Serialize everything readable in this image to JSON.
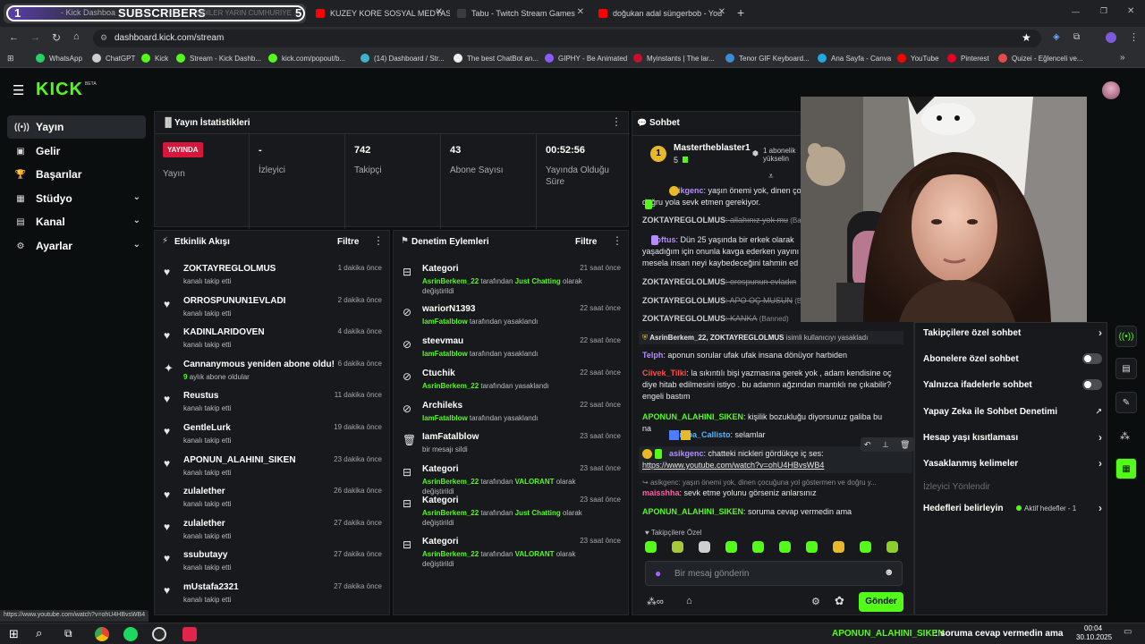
{
  "browser": {
    "tabs": [
      {
        "title": "- Kick Dashboa",
        "overlay": "SUBSCRIBERS",
        "overlay_left": "1",
        "overlay_right": "5",
        "ticker": "NDİLER YARIN CUMHURİYE"
      },
      {
        "title": "KUZEY KORE SOSYAL MEDYASI"
      },
      {
        "title": "Tabu - Twitch Stream Games"
      },
      {
        "title": "doğukan adal süngerbob - You"
      }
    ],
    "new_tab": "+",
    "url": "dashboard.kick.com/stream",
    "bookmarks": [
      "WhatsApp",
      "ChatGPT",
      "Kick",
      "Stream - Kick Dashb...",
      "kick.com/popout/b...",
      "(14) Dashboard / Str...",
      "The best ChatBot an...",
      "GIPHY - Be Animated",
      "Myinstants | The lar...",
      "Tenor GIF Keyboard...",
      "Ana Sayfa - Canva",
      "YouTube",
      "Pinterest",
      "Quizei - Eğlenceli ve..."
    ],
    "bookmark_colors": [
      "#25d366",
      "#cfcfcf",
      "#53fc18",
      "#53fc18",
      "#53fc18",
      "#3fb3c8",
      "#eeeeee",
      "#8a5cff",
      "#c8102e",
      "#3b8dd8",
      "#21a8e0",
      "#ff0000",
      "#e60023",
      "#e54b4b"
    ],
    "status_url": "https://www.youtube.com/watch?v=ohU4HBvsWB4"
  },
  "kick": {
    "logo": "KICK",
    "logo_sup": "BETA"
  },
  "sidebar": {
    "items": [
      {
        "label": "Yayın",
        "icon": "broadcast-icon",
        "glyph": "((•))",
        "active": true,
        "chevron": false
      },
      {
        "label": "Gelir",
        "icon": "income-icon",
        "glyph": "▣",
        "active": false,
        "chevron": false
      },
      {
        "label": "Başarılar",
        "icon": "trophy-icon",
        "glyph": "🏆",
        "active": false,
        "chevron": false
      },
      {
        "label": "Stüdyo",
        "icon": "studio-icon",
        "glyph": "▦",
        "active": false,
        "chevron": true
      },
      {
        "label": "Kanal",
        "icon": "channel-icon",
        "glyph": "▤",
        "active": false,
        "chevron": true
      },
      {
        "label": "Ayarlar",
        "icon": "settings-icon",
        "glyph": "⚙",
        "active": false,
        "chevron": true
      }
    ]
  },
  "stats": {
    "title": "Yayın İstatistikleri",
    "live_badge": "YAYINDA",
    "live_label": "Yayın",
    "cells": [
      {
        "value": "-",
        "label": "İzleyici"
      },
      {
        "value": "742",
        "label": "Takipçi"
      },
      {
        "value": "43",
        "label": "Abone Sayısı"
      },
      {
        "value": "00:52:56",
        "label": "Yayında Olduğu Süre"
      }
    ]
  },
  "activity": {
    "title": "Etkinlik Akışı",
    "filter": "Filtre",
    "items": [
      {
        "name": "ZOKTAYREGLOLMUS",
        "sub": "kanalı takip etti",
        "time": "1 dakika önce",
        "kind": "follow"
      },
      {
        "name": "ORROSPUNUN1EVLADI",
        "sub": "kanalı takip etti",
        "time": "2 dakika önce",
        "kind": "follow"
      },
      {
        "name": "KADINLARIDOVEN",
        "sub": "kanalı takip etti",
        "time": "4 dakika önce",
        "kind": "follow"
      },
      {
        "name": "Cannanymous yeniden abone oldu!",
        "sub_num": "9",
        "sub": "aylık abone oldular",
        "time": "6 dakika önce",
        "kind": "sub"
      },
      {
        "name": "Reustus",
        "sub": "kanalı takip etti",
        "time": "11 dakika önce",
        "kind": "follow"
      },
      {
        "name": "GentleLurk",
        "sub": "kanalı takip etti",
        "time": "19 dakika önce",
        "kind": "follow"
      },
      {
        "name": "APONUN_ALAHINI_SIKEN",
        "sub": "kanalı takip etti",
        "time": "23 dakika önce",
        "kind": "follow"
      },
      {
        "name": "zulalether",
        "sub": "kanalı takip etti",
        "time": "26 dakika önce",
        "kind": "follow"
      },
      {
        "name": "zulalether",
        "sub": "kanalı takip etti",
        "time": "27 dakika önce",
        "kind": "follow"
      },
      {
        "name": "ssubutayy",
        "sub": "kanalı takip etti",
        "time": "27 dakika önce",
        "kind": "follow"
      },
      {
        "name": "mUstafa2321",
        "sub": "kanalı takip etti",
        "time": "27 dakika önce",
        "kind": "follow"
      }
    ]
  },
  "moderation": {
    "title": "Denetim Eylemleri",
    "filter": "Filtre",
    "items": [
      {
        "name": "Kategori",
        "actor": "AsrinBerkem_22",
        "mid": " tarafından ",
        "target": "Just Chatting",
        "tail": " olarak değiştirildi",
        "time": "21 saat önce",
        "kind": "category"
      },
      {
        "name": "wariorN1393",
        "actor": "IamFatalblow",
        "mid": " tarafından yasaklandı",
        "target": "",
        "tail": "",
        "time": "22 saat önce",
        "kind": "ban"
      },
      {
        "name": "steevmau",
        "actor": "IamFatalblow",
        "mid": " tarafından yasaklandı",
        "target": "",
        "tail": "",
        "time": "22 saat önce",
        "kind": "ban"
      },
      {
        "name": "Ctuchik",
        "actor": "AsrinBerkem_22",
        "mid": " tarafından yasaklandı",
        "target": "",
        "tail": "",
        "time": "22 saat önce",
        "kind": "ban"
      },
      {
        "name": "Archileks",
        "actor": "IamFatalblow",
        "mid": " tarafından yasaklandı",
        "target": "",
        "tail": "",
        "time": "22 saat önce",
        "kind": "ban"
      },
      {
        "name": "IamFatalblow",
        "actor": "",
        "mid": "bir mesajı sildi",
        "target": "",
        "tail": "",
        "time": "23 saat önce",
        "kind": "delete"
      },
      {
        "name": "Kategori",
        "actor": "AsrinBerkem_22",
        "mid": " tarafından ",
        "target": "VALORANT",
        "tail": " olarak değiştirildi",
        "time": "23 saat önce",
        "kind": "category"
      },
      {
        "name": "Kategori",
        "actor": "AsrinBerkem_22",
        "mid": " tarafından ",
        "target": "Just Chatting",
        "tail": " olarak değiştirildi",
        "time": "23 saat önce",
        "kind": "category"
      },
      {
        "name": "Kategori",
        "actor": "AsrinBerkem_22",
        "mid": " tarafından ",
        "target": "VALORANT",
        "tail": " olarak değiştirildi",
        "time": "23 saat önce",
        "kind": "category"
      }
    ]
  },
  "chat": {
    "title": "Sohbet",
    "pinned_user": "Mastertheblaster1",
    "pinned_rank": "1",
    "pinned_count": "5",
    "pinned_note_1": "1 abonelik",
    "pinned_note_2": "yükselin",
    "messages": [
      {
        "user": "asikgenc",
        "color": "#b48cff",
        "text": ": yaşın önemi yok, dinen ço",
        "text2": "doğru yola sevk etmen gerekiyor.",
        "badges": "gold"
      },
      {
        "user": "ZOKTAYREGLOLMUS",
        "color": "#c9cdd2",
        "text": ": allahınız yok mu",
        "tag": " (Ba",
        "deleted": true
      },
      {
        "user": "noftus",
        "color": "#b48cff",
        "text": ": Dün 25 yaşında bir erkek olarak",
        "text2": "yaşadığım için onunla kavga ederken yayını",
        "text3": "mesela insan neyi kaybedeceğini tahmin ed"
      },
      {
        "user": "ZOKTAYREGLOLMUS",
        "color": "#c9cdd2",
        "text": ": orospunun evladın",
        "tag": "",
        "deleted": true
      },
      {
        "user": "ZOKTAYREGLOLMUS",
        "color": "#c9cdd2",
        "text": ": APO OÇ MUSUN",
        "tag": " (Ba",
        "deleted": true
      },
      {
        "user": "ZOKTAYREGLOLMUS",
        "color": "#c9cdd2",
        "text": ": KANKA",
        "tag": " (Banned)",
        "deleted": true
      }
    ],
    "system": {
      "who": "AsrinBerkem_22, ZOKTAYREGLOLMUS",
      "text": " isimli kullanıcıyı yasakladı"
    },
    "messages2": [
      {
        "user": "Telph",
        "color": "#b48cff",
        "text": ": aponun sorular ufak ufak insana dönüyor harbiden"
      },
      {
        "user": "Ciivek_Tilki",
        "color": "#ff4d4d",
        "text": ": la sıkıntılı bişi yazmasına gerek yok , adam kendisine oç",
        "text2": "diye hitab edilmesini istiyo . bu adamın ağzından mantıklı ne çıkabilir?",
        "text3": "engeli bastım"
      },
      {
        "user": "APONUN_ALAHINI_SIKEN",
        "color": "#53fc18",
        "text": ": kişilik bozukluğu diyorsunuz galiba bu",
        "text2": "na"
      },
      {
        "user": "Europa_Callisto",
        "color": "#4db8ff",
        "text": ": selamlar"
      }
    ],
    "hover_msg": {
      "user": "asikgenc",
      "text": ": chatteki nickleri gördükçe iç ses:",
      "link": "https://www.youtube.com/watch?v=ohU4HBvsWB4"
    },
    "reply_preview": "asikgenc: yaşın önemi yok, dinen çocuğuna yol göstermen ve doğru y...",
    "messages3": [
      {
        "user": "maisshha",
        "color": "#ff5ca8",
        "text": ": sevk etme yolunu görseniz anlarsınız"
      },
      {
        "user": "APONUN_ALAHINI_SIKEN",
        "color": "#53fc18",
        "text": ": soruma cevap vermedin ama"
      }
    ],
    "followers_only": "Takipçilere Özel",
    "input_placeholder": "Bir mesaj gönderin",
    "send_label": "Gönder"
  },
  "chat_menu": {
    "items": [
      {
        "label": "Takipçilere özel sohbet",
        "control": "chevron"
      },
      {
        "label": "Abonelere özel sohbet",
        "control": "toggle"
      },
      {
        "label": "Yalnızca ifadelerle sohbet",
        "control": "toggle"
      },
      {
        "label": "Yapay Zeka ile Sohbet Denetimi",
        "control": "external"
      },
      {
        "label": "Hesap yaşı kısıtlaması",
        "control": "chevron"
      },
      {
        "label": "Yasaklanmış kelimeler",
        "control": "chevron"
      },
      {
        "label": "İzleyici Yönlendir",
        "control": "none",
        "disabled": true
      },
      {
        "label": "Hedefleri belirleyin",
        "control": "goal",
        "extra": "Aktif hedefler - 1"
      }
    ]
  },
  "taskbar": {
    "ticker_user": "APONUN_ALAHINI_SIKEN",
    "ticker_text": ": soruma cevap vermedin ama",
    "time": "00:04",
    "date": "30.10.2025"
  },
  "colors": {
    "accent": "#53fc18",
    "live": "#d6173b",
    "panel": "#17191c"
  }
}
